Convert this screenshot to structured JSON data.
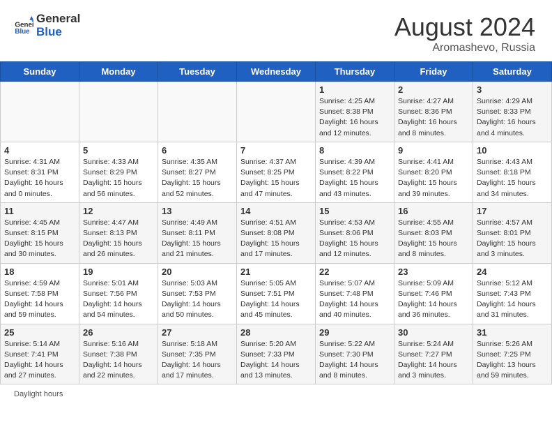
{
  "header": {
    "logo_general": "General",
    "logo_blue": "Blue",
    "month_year": "August 2024",
    "location": "Aromashevo, Russia"
  },
  "days_of_week": [
    "Sunday",
    "Monday",
    "Tuesday",
    "Wednesday",
    "Thursday",
    "Friday",
    "Saturday"
  ],
  "weeks": [
    [
      {
        "day": "",
        "info": ""
      },
      {
        "day": "",
        "info": ""
      },
      {
        "day": "",
        "info": ""
      },
      {
        "day": "",
        "info": ""
      },
      {
        "day": "1",
        "info": "Sunrise: 4:25 AM\nSunset: 8:38 PM\nDaylight: 16 hours and 12 minutes."
      },
      {
        "day": "2",
        "info": "Sunrise: 4:27 AM\nSunset: 8:36 PM\nDaylight: 16 hours and 8 minutes."
      },
      {
        "day": "3",
        "info": "Sunrise: 4:29 AM\nSunset: 8:33 PM\nDaylight: 16 hours and 4 minutes."
      }
    ],
    [
      {
        "day": "4",
        "info": "Sunrise: 4:31 AM\nSunset: 8:31 PM\nDaylight: 16 hours and 0 minutes."
      },
      {
        "day": "5",
        "info": "Sunrise: 4:33 AM\nSunset: 8:29 PM\nDaylight: 15 hours and 56 minutes."
      },
      {
        "day": "6",
        "info": "Sunrise: 4:35 AM\nSunset: 8:27 PM\nDaylight: 15 hours and 52 minutes."
      },
      {
        "day": "7",
        "info": "Sunrise: 4:37 AM\nSunset: 8:25 PM\nDaylight: 15 hours and 47 minutes."
      },
      {
        "day": "8",
        "info": "Sunrise: 4:39 AM\nSunset: 8:22 PM\nDaylight: 15 hours and 43 minutes."
      },
      {
        "day": "9",
        "info": "Sunrise: 4:41 AM\nSunset: 8:20 PM\nDaylight: 15 hours and 39 minutes."
      },
      {
        "day": "10",
        "info": "Sunrise: 4:43 AM\nSunset: 8:18 PM\nDaylight: 15 hours and 34 minutes."
      }
    ],
    [
      {
        "day": "11",
        "info": "Sunrise: 4:45 AM\nSunset: 8:15 PM\nDaylight: 15 hours and 30 minutes."
      },
      {
        "day": "12",
        "info": "Sunrise: 4:47 AM\nSunset: 8:13 PM\nDaylight: 15 hours and 26 minutes."
      },
      {
        "day": "13",
        "info": "Sunrise: 4:49 AM\nSunset: 8:11 PM\nDaylight: 15 hours and 21 minutes."
      },
      {
        "day": "14",
        "info": "Sunrise: 4:51 AM\nSunset: 8:08 PM\nDaylight: 15 hours and 17 minutes."
      },
      {
        "day": "15",
        "info": "Sunrise: 4:53 AM\nSunset: 8:06 PM\nDaylight: 15 hours and 12 minutes."
      },
      {
        "day": "16",
        "info": "Sunrise: 4:55 AM\nSunset: 8:03 PM\nDaylight: 15 hours and 8 minutes."
      },
      {
        "day": "17",
        "info": "Sunrise: 4:57 AM\nSunset: 8:01 PM\nDaylight: 15 hours and 3 minutes."
      }
    ],
    [
      {
        "day": "18",
        "info": "Sunrise: 4:59 AM\nSunset: 7:58 PM\nDaylight: 14 hours and 59 minutes."
      },
      {
        "day": "19",
        "info": "Sunrise: 5:01 AM\nSunset: 7:56 PM\nDaylight: 14 hours and 54 minutes."
      },
      {
        "day": "20",
        "info": "Sunrise: 5:03 AM\nSunset: 7:53 PM\nDaylight: 14 hours and 50 minutes."
      },
      {
        "day": "21",
        "info": "Sunrise: 5:05 AM\nSunset: 7:51 PM\nDaylight: 14 hours and 45 minutes."
      },
      {
        "day": "22",
        "info": "Sunrise: 5:07 AM\nSunset: 7:48 PM\nDaylight: 14 hours and 40 minutes."
      },
      {
        "day": "23",
        "info": "Sunrise: 5:09 AM\nSunset: 7:46 PM\nDaylight: 14 hours and 36 minutes."
      },
      {
        "day": "24",
        "info": "Sunrise: 5:12 AM\nSunset: 7:43 PM\nDaylight: 14 hours and 31 minutes."
      }
    ],
    [
      {
        "day": "25",
        "info": "Sunrise: 5:14 AM\nSunset: 7:41 PM\nDaylight: 14 hours and 27 minutes."
      },
      {
        "day": "26",
        "info": "Sunrise: 5:16 AM\nSunset: 7:38 PM\nDaylight: 14 hours and 22 minutes."
      },
      {
        "day": "27",
        "info": "Sunrise: 5:18 AM\nSunset: 7:35 PM\nDaylight: 14 hours and 17 minutes."
      },
      {
        "day": "28",
        "info": "Sunrise: 5:20 AM\nSunset: 7:33 PM\nDaylight: 14 hours and 13 minutes."
      },
      {
        "day": "29",
        "info": "Sunrise: 5:22 AM\nSunset: 7:30 PM\nDaylight: 14 hours and 8 minutes."
      },
      {
        "day": "30",
        "info": "Sunrise: 5:24 AM\nSunset: 7:27 PM\nDaylight: 14 hours and 3 minutes."
      },
      {
        "day": "31",
        "info": "Sunrise: 5:26 AM\nSunset: 7:25 PM\nDaylight: 13 hours and 59 minutes."
      }
    ]
  ],
  "footer": {
    "note": "Daylight hours"
  }
}
